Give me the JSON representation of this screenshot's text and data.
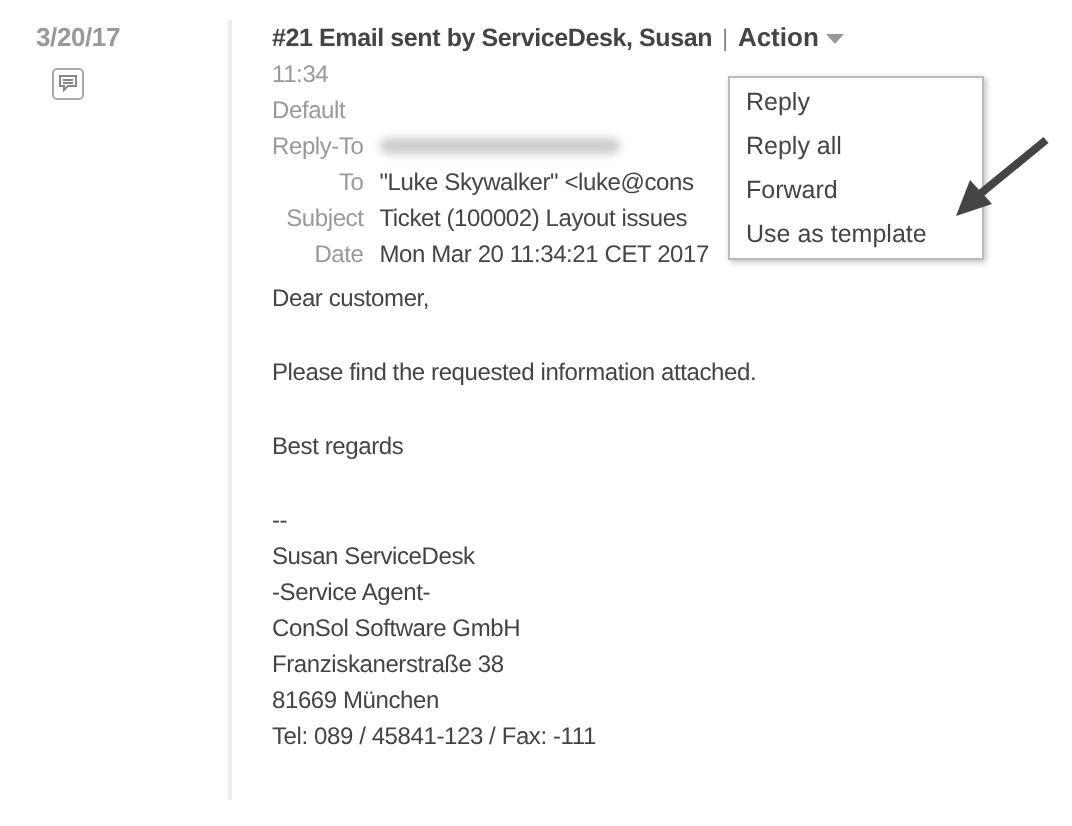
{
  "date": "3/20/17",
  "entry": {
    "title": "#21 Email sent by ServiceDesk, Susan",
    "separator": "|",
    "action": "Action",
    "time": "11:34",
    "template": "Default",
    "headers": [
      {
        "label": "Reply-To",
        "blurred": true
      },
      {
        "label": "To",
        "value": "\"Luke Skywalker\" <luke@cons"
      },
      {
        "label": "Subject",
        "value": "Ticket (100002) Layout issues"
      },
      {
        "label": "Date",
        "value": "Mon Mar 20 11:34:21 CET 2017"
      }
    ],
    "body": [
      {
        "lines": [
          "Dear customer,"
        ]
      },
      {
        "lines": [
          "Please find the requested information attached."
        ]
      },
      {
        "lines": [
          "Best regards"
        ]
      },
      {
        "lines": [
          "--",
          "Susan ServiceDesk",
          "-Service Agent-",
          "ConSol Software GmbH",
          "Franziskanerstraße 38",
          "81669 München",
          "Tel: 089 / 45841-123 / Fax: -111"
        ]
      }
    ]
  },
  "action_menu": {
    "items": [
      "Reply",
      "Reply all",
      "Forward",
      "Use as template"
    ]
  }
}
